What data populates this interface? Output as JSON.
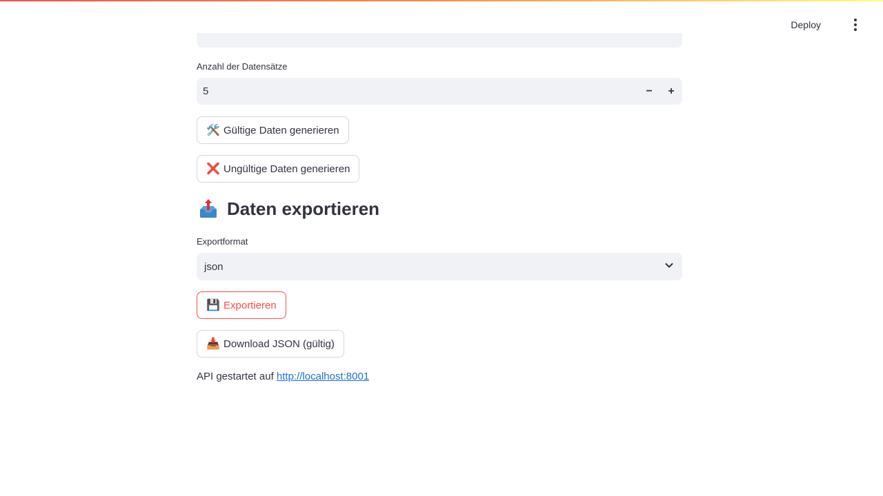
{
  "header": {
    "deploy_label": "Deploy",
    "menu_icon": "kebab-menu-icon"
  },
  "records": {
    "label": "Anzahl der Datensätze",
    "value": "5",
    "decrement_label": "−",
    "increment_label": "+"
  },
  "buttons": {
    "valid": {
      "icon": "🛠️",
      "label": "Gültige Daten generieren"
    },
    "invalid": {
      "icon": "❌",
      "label": "Ungültige Daten generieren"
    },
    "export": {
      "icon": "💾",
      "label": "Exportieren"
    },
    "download": {
      "icon": "📥",
      "label": "Download JSON (gültig)"
    }
  },
  "export_section": {
    "heading": "Daten exportieren",
    "heading_icon": "outbox-tray-icon",
    "format_label": "Exportformat",
    "format_value": "json"
  },
  "api": {
    "text": "API gestartet auf ",
    "link": "http://localhost:8001"
  },
  "colors": {
    "accent": "#ff4b4b",
    "input_bg": "#f0f2f6",
    "link": "#1c6fd1",
    "text": "#31333f"
  }
}
